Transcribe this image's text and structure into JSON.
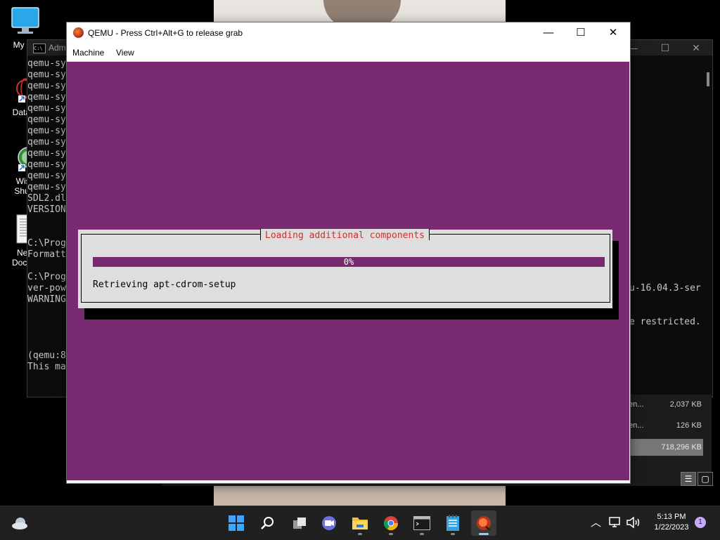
{
  "desktop": {
    "icons": [
      {
        "label": "My Co",
        "icon": "computer-icon"
      },
      {
        "label": "DataW",
        "icon": "datawarrior-icon"
      },
      {
        "label": "Wise",
        "label2": "Shuto",
        "icon": "wise-shutdown-icon"
      },
      {
        "label": "New",
        "label2": "Docum",
        "icon": "text-document-icon"
      }
    ]
  },
  "cmd": {
    "title": "Adm",
    "lines": [
      "qemu-sy",
      "qemu-sy",
      "qemu-sy",
      "qemu-sy",
      "qemu-sy",
      "qemu-sy",
      "qemu-sy",
      "qemu-sy",
      "qemu-sy",
      "qemu-sy",
      "qemu-sy",
      "qemu-sy",
      "SDL2.dl",
      "VERSION",
      "",
      "",
      "C:\\Prog",
      "Formatt",
      "",
      "C:\\Prog",
      "ver-pow",
      "WARNING",
      "",
      "",
      "",
      "",
      "(qemu:8",
      "This ma"
    ],
    "right_line_1": "u-16.04.3-ser",
    "right_line_2": "e restricted."
  },
  "explorer": {
    "rows": [
      {
        "name": "en...",
        "size": "2,037 KB"
      },
      {
        "name": "en...",
        "size": "126 KB"
      },
      {
        "name": "",
        "size": "718,296 KB"
      }
    ]
  },
  "qemu": {
    "title": "QEMU - Press Ctrl+Alt+G to release grab",
    "menu": [
      "Machine",
      "View"
    ],
    "guest_bg": "#772a6f"
  },
  "installer": {
    "title": "Loading additional components",
    "progress_percent": 0,
    "progress_label": "0%",
    "status": "Retrieving apt-cdrom-setup"
  },
  "taskbar": {
    "apps": [
      "start-icon",
      "search-icon",
      "task-view-icon",
      "chat-icon",
      "file-explorer-icon",
      "chrome-icon",
      "terminal-icon",
      "notepad-icon",
      "qemu-icon"
    ],
    "clock_time": "5:13 PM",
    "clock_date": "1/22/2023",
    "notification_count": "1"
  }
}
